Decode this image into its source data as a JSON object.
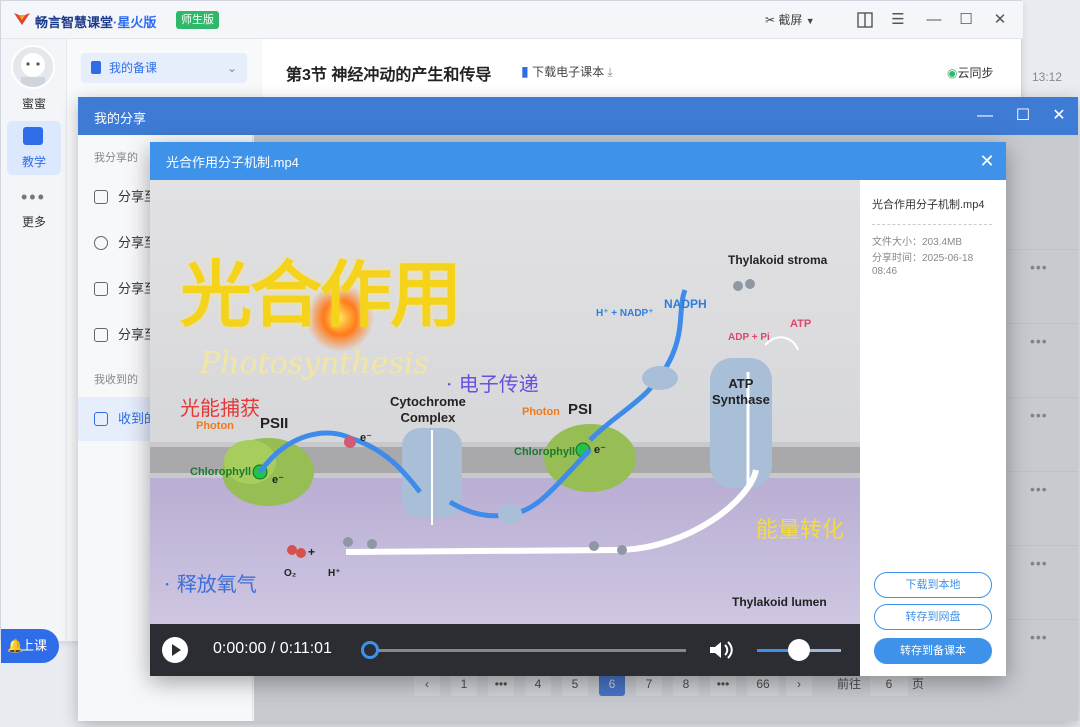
{
  "app": {
    "name": "畅言智慧课堂",
    "sub_name": "·星火版",
    "edition": "师生版",
    "screenshot_label": "截屏",
    "time": "13:12"
  },
  "rail": {
    "user_name": "蜜蜜",
    "items": [
      {
        "label": "教学"
      },
      {
        "label": "更多"
      }
    ],
    "class_button": "上课"
  },
  "subpanel": {
    "my_lessons": "我的备课",
    "lesson_title": "第3节 神经冲动的产生和传导",
    "download_ebook": "下载电子课本",
    "cloud_sync": "云同步"
  },
  "share_dialog": {
    "title": "我的分享",
    "section_shared": "我分享的",
    "items": [
      {
        "label": "分享至"
      },
      {
        "label": "分享至"
      },
      {
        "label": "分享至"
      },
      {
        "label": "分享至"
      }
    ],
    "section_received": "我收到的",
    "received_item": "收到的",
    "pagination": {
      "pages": [
        "1",
        "•••",
        "4",
        "5",
        "6",
        "7",
        "8",
        "•••",
        "66"
      ],
      "current": "6",
      "goto_label": "前往",
      "goto_value": "6",
      "goto_suffix": "页"
    }
  },
  "video_dialog": {
    "title": "光合作用分子机制.mp4",
    "current_time": "0:00:00",
    "separator": "/",
    "duration": "0:11:01",
    "progress": 0,
    "volume": 0.5,
    "scene": {
      "title_zh": "光合作用",
      "title_en": "Photosynthesis",
      "light_capture": "光能捕获",
      "electron_transfer": "· 电子传递",
      "energy_conversion": "能量转化",
      "oxygen_release": "· 释放氧气",
      "psii": "PSII",
      "psi": "PSI",
      "photon1": "Photon",
      "photon2": "Photon",
      "chlorophyll1": "Chlorophyll",
      "chlorophyll2": "Chlorophyll",
      "cytochrome": "Cytochrome\nComplex",
      "thylakoid_stroma": "Thylakoid stroma",
      "thylakoid_lumen": "Thylakoid lumen",
      "nadph": "NADPH",
      "h_nadp": "H⁺ + NADP⁺",
      "adp_pi": "ADP + Pi",
      "atp": "ATP",
      "atp_synthase": "ATP\nSynthase",
      "e_minus": "e⁻",
      "o2": "O₂",
      "h_plus": "H⁺",
      "plus": "+"
    },
    "info": {
      "file_name": "光合作用分子机制.mp4",
      "size_label": "文件大小：203.4MB",
      "time_label": "分享时间：2025-06-18 08:46",
      "btn_download": "下载到本地",
      "btn_save_disk": "转存到网盘",
      "btn_save_lesson": "转存到备课本"
    }
  },
  "colors": {
    "accent": "#3f92e9",
    "brand": "#2f6de8",
    "edition": "#31b76a"
  }
}
